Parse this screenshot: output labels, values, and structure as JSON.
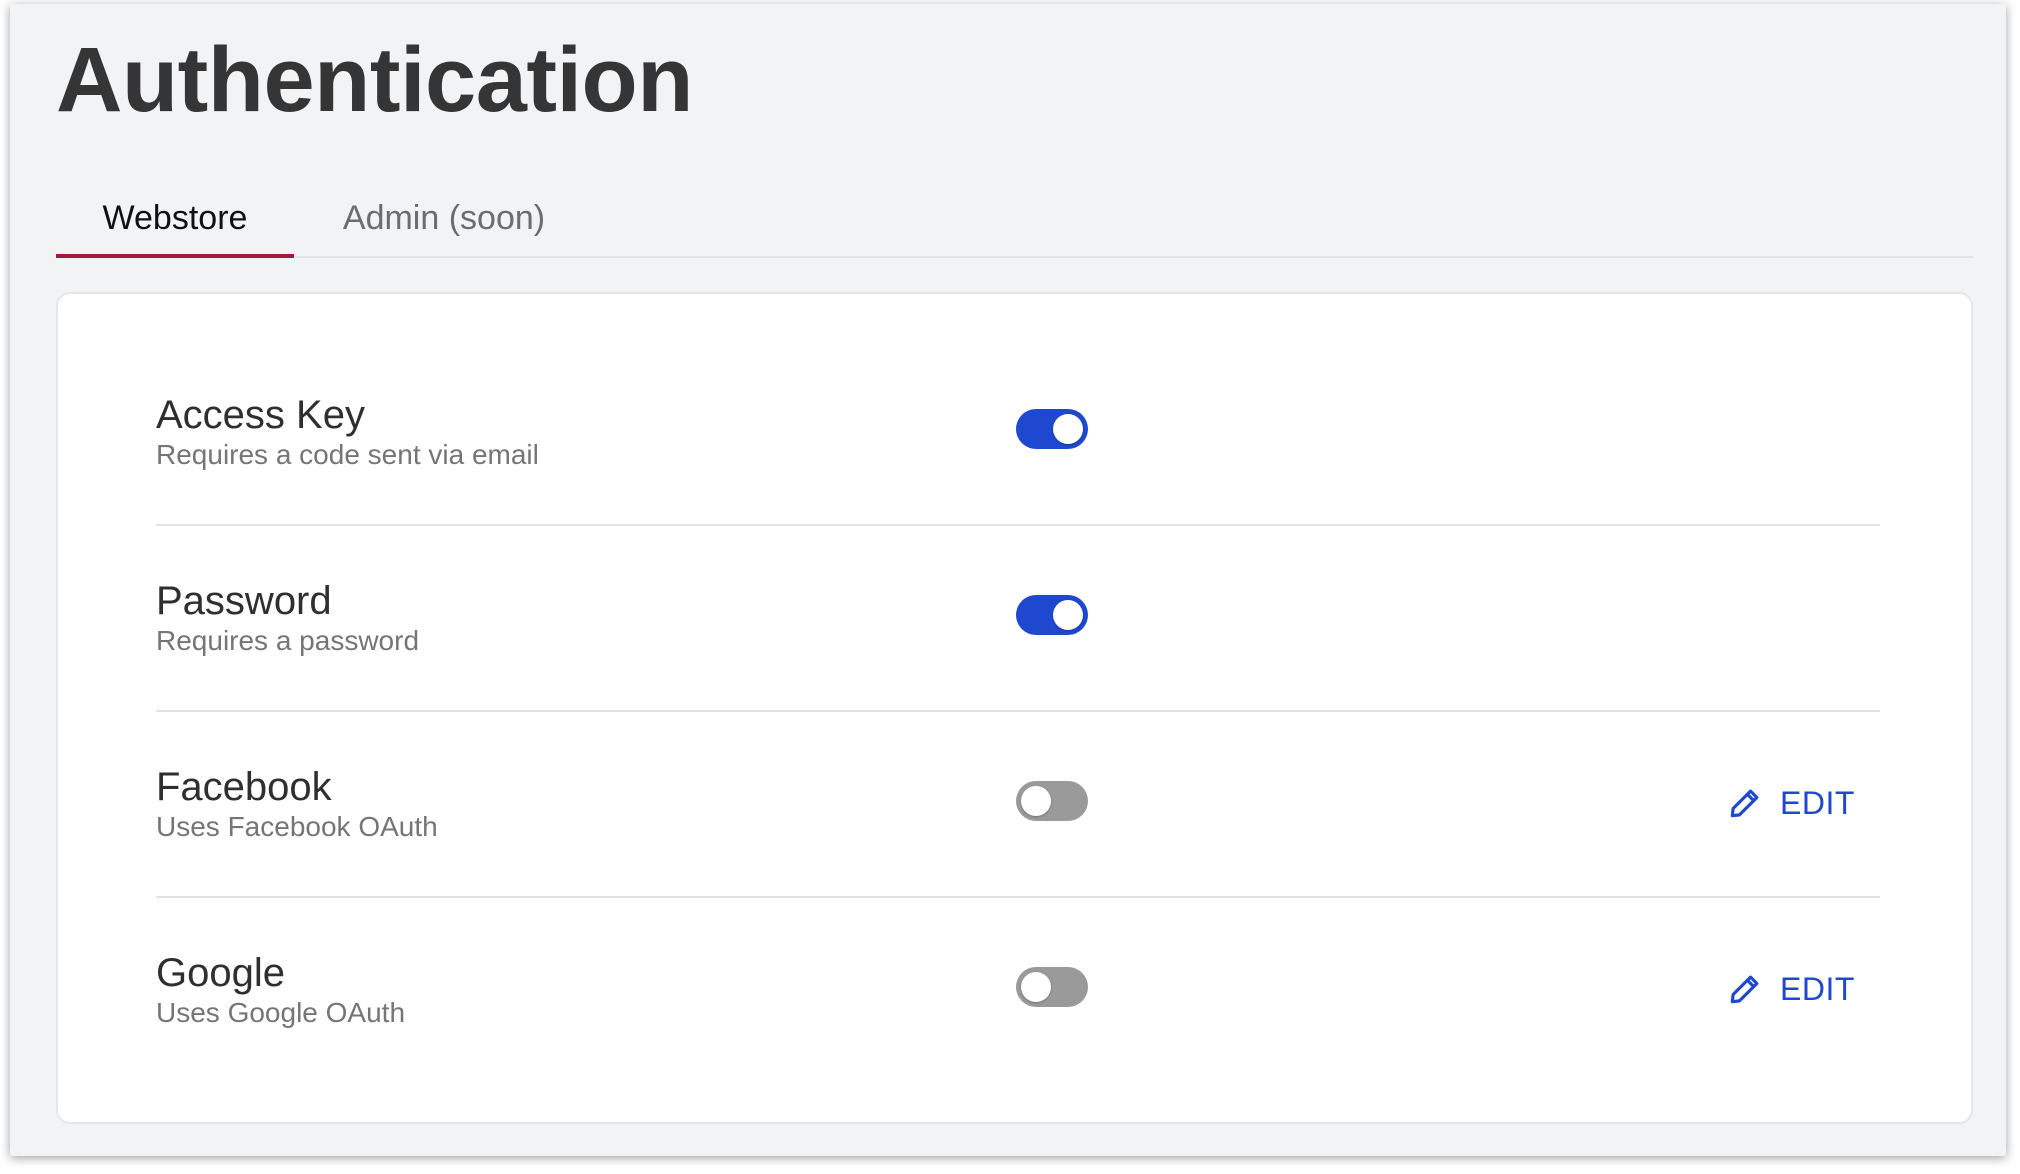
{
  "page": {
    "title": "Authentication"
  },
  "tabs": [
    {
      "label": "Webstore",
      "active": true
    },
    {
      "label": "Admin (soon)",
      "active": false
    }
  ],
  "methods": [
    {
      "title": "Access Key",
      "description": "Requires a code sent via email",
      "enabled": true,
      "editable": false
    },
    {
      "title": "Password",
      "description": "Requires a password",
      "enabled": true,
      "editable": false
    },
    {
      "title": "Facebook",
      "description": "Uses Facebook OAuth",
      "enabled": false,
      "editable": true,
      "edit_label": "EDIT",
      "edit_icon": "pencil-icon"
    },
    {
      "title": "Google",
      "description": "Uses Google OAuth",
      "enabled": false,
      "editable": true,
      "edit_label": "EDIT",
      "edit_icon": "pencil-icon"
    }
  ],
  "colors": {
    "accent": "#1f48d0",
    "active_tab_underline": "#a3173d",
    "toggle_off": "#9a9a9a",
    "background": "#f2f3f5"
  }
}
